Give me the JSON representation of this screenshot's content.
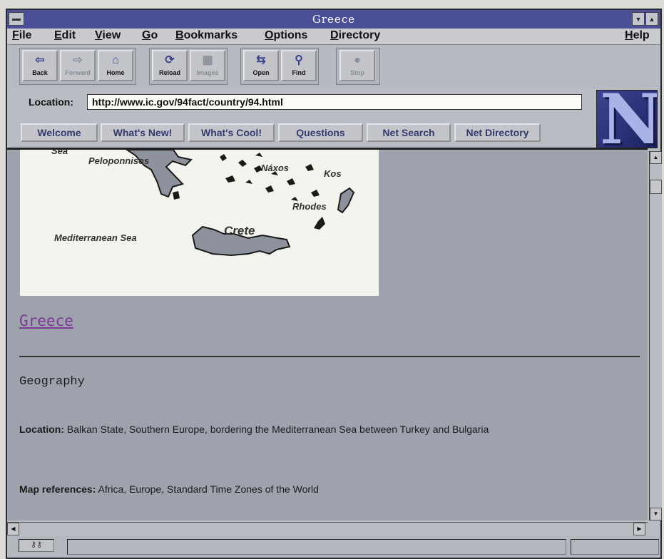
{
  "window": {
    "title": "Greece"
  },
  "menu": {
    "file": "File",
    "edit": "Edit",
    "view": "View",
    "go": "Go",
    "bookmarks": "Bookmarks",
    "options": "Options",
    "directory": "Directory",
    "help": "Help"
  },
  "toolbar": {
    "back": "Back",
    "forward": "Forward",
    "home": "Home",
    "reload": "Reload",
    "images": "Images",
    "open": "Open",
    "find": "Find",
    "stop": "Stop"
  },
  "location": {
    "label": "Location:",
    "url": "http://www.ic.gov/94fact/country/94.html"
  },
  "directory_buttons": {
    "welcome": "Welcome",
    "whats_new": "What's New!",
    "whats_cool": "What's Cool!",
    "questions": "Questions",
    "net_search": "Net Search",
    "net_directory": "Net Directory"
  },
  "map": {
    "sea_fragment": "Sea",
    "peloponnisos": "Peloponnisos",
    "naxos": "Náxos",
    "kos": "Kos",
    "rhodes": "Rhodes",
    "crete": "Crete",
    "mediterranean": "Mediterranean Sea"
  },
  "content": {
    "page_link": "Greece",
    "section_heading": "Geography",
    "location_label": "Location:",
    "location_text": " Balkan State, Southern Europe, bordering the Mediterranean Sea between Turkey and Bulgaria",
    "mapref_label": "Map references:",
    "mapref_text": " Africa, Europe, Standard Time Zones of the World"
  },
  "colors": {
    "titlebar": "#4a4f97",
    "content_bg": "#9da2ac",
    "visited_link": "#7b3a93"
  }
}
